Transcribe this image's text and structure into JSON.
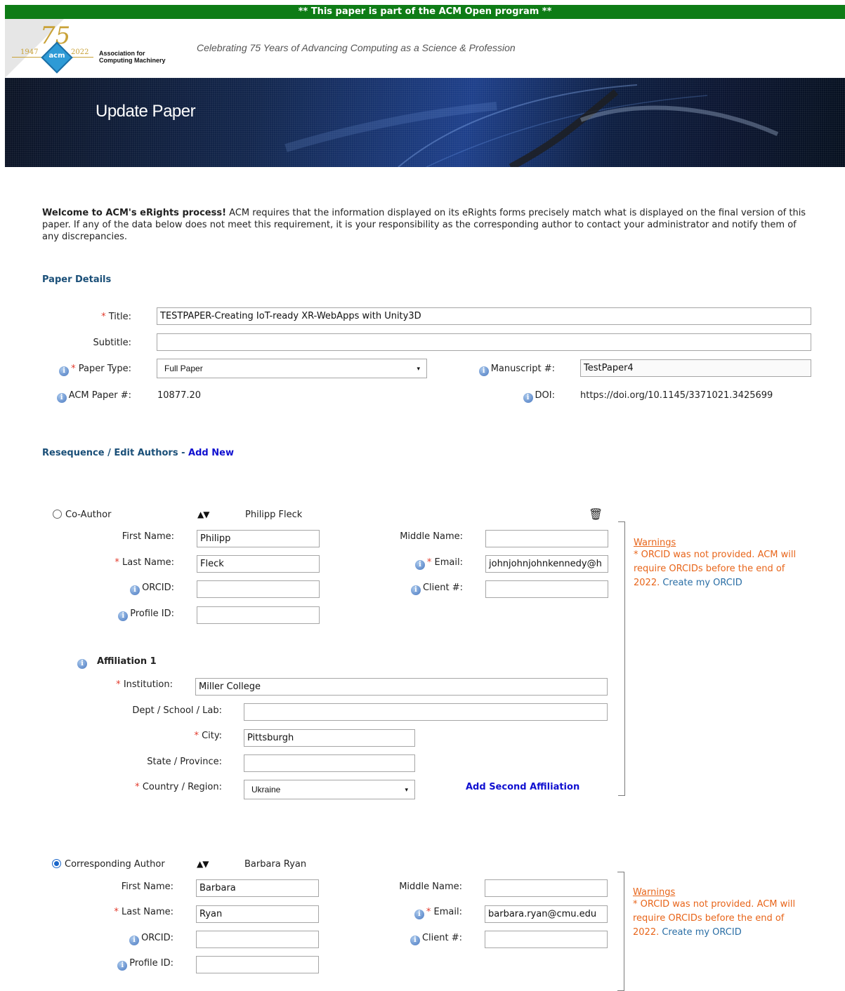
{
  "banner": "** This paper is part of the ACM Open program **",
  "logo": {
    "anniversary": "75",
    "year_start": "1947",
    "year_end": "2022",
    "mark": "acm",
    "org_line1": "Association for",
    "org_line2": "Computing Machinery"
  },
  "tagline": "Celebrating 75 Years of Advancing Computing as a Science & Profession",
  "hero_title": "Update Paper",
  "welcome": {
    "bold": "Welcome to ACM's eRights process!",
    "text": " ACM requires that the information displayed on its eRights forms precisely match what is displayed on the final version of this paper. If any of the data below does not meet this requirement, it is your responsibility as the corresponding author to contact your administrator and notify them of any discrepancies."
  },
  "paper_details": {
    "heading": "Paper Details",
    "title_label": "Title:",
    "title_value": "TESTPAPER-Creating IoT-ready XR-WebApps with Unity3D",
    "subtitle_label": "Subtitle:",
    "subtitle_value": "",
    "paper_type_label": "Paper Type:",
    "paper_type_value": "Full Paper",
    "manuscript_label": "Manuscript #:",
    "manuscript_value": "TestPaper4",
    "acm_paper_label": "ACM Paper #:",
    "acm_paper_value": "10877.20",
    "doi_label": "DOI:",
    "doi_value": "https://doi.org/10.1145/3371021.3425699"
  },
  "authors_section": {
    "heading": "Resequence / Edit Authors",
    "separator": " - ",
    "add_new": "Add New"
  },
  "labels": {
    "first_name": "First Name:",
    "middle_name": "Middle Name:",
    "last_name": "Last Name:",
    "email": "Email:",
    "orcid": "ORCID:",
    "client": "Client #:",
    "profile_id": "Profile ID:",
    "affiliation": "Affiliation 1",
    "institution": "Institution:",
    "dept": "Dept / School / Lab:",
    "city": "City:",
    "state": "State / Province:",
    "country": "Country / Region:",
    "add_second_affiliation": "Add Second Affiliation",
    "required_mark": "*"
  },
  "warnings": {
    "title": "Warnings",
    "line1": "* ORCID was not provided. ACM will",
    "line2": "require ORCIDs before the end of",
    "line3_prefix": "2022. ",
    "link": "Create my ORCID"
  },
  "author1": {
    "role": "Co-Author",
    "selected": false,
    "display_name": "Philipp Fleck",
    "first_name": "Philipp",
    "middle_name": "",
    "last_name": "Fleck",
    "email": "johnjohnjohnkennedy@h",
    "orcid": "",
    "client": "",
    "profile_id": "",
    "institution": "Miller College",
    "dept": "",
    "city": "Pittsburgh",
    "state": "",
    "country": "Ukraine"
  },
  "author2": {
    "role": "Corresponding Author",
    "selected": true,
    "display_name": "Barbara Ryan",
    "first_name": "Barbara",
    "middle_name": "",
    "last_name": "Ryan",
    "email": "barbara.ryan@cmu.edu",
    "orcid": "",
    "client": "",
    "profile_id": ""
  },
  "icons": {
    "info": "i",
    "trash": "🗑",
    "up_down": "▲▼",
    "caret": "▾"
  },
  "colors": {
    "banner_green": "#0e7c16",
    "heading_blue": "#1a4f78",
    "required_red": "#e23a2c",
    "warning_orange": "#e8651a",
    "link_blue": "#1010d0"
  }
}
